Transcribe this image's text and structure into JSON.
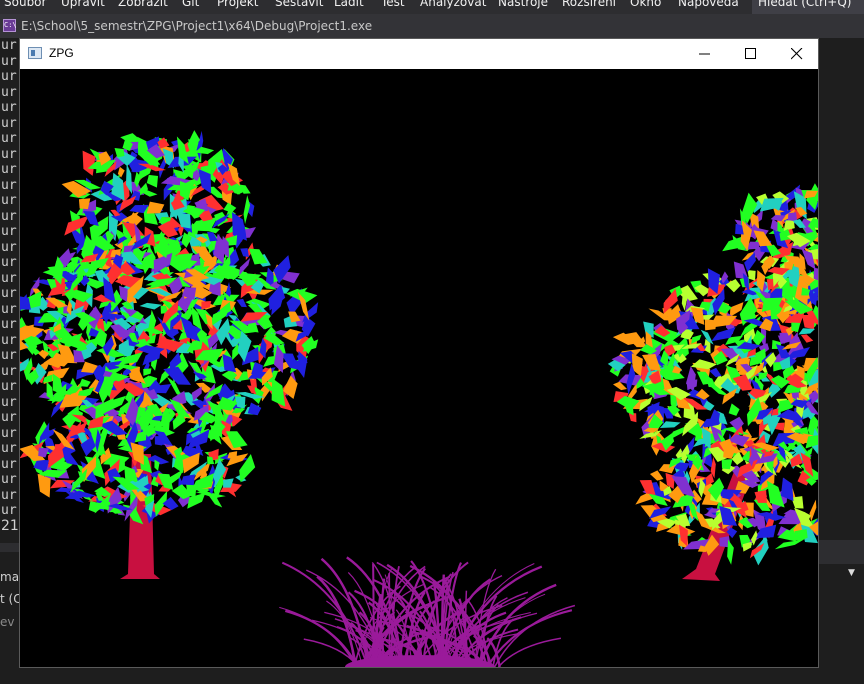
{
  "menubar": {
    "items": [
      "Soubor",
      "Upravit",
      "Zobrazit",
      "Git",
      "Projekt",
      "Sestavit",
      "Ladit",
      "Test",
      "Analyzovat",
      "Nástroje",
      "Rozšíření",
      "Okno",
      "Nápověda"
    ],
    "search_label": "Hledat (Ctrl+Q)"
  },
  "console": {
    "icon_label": "C:\\",
    "path": "E:\\School\\5_semestr\\ZPG\\Project1\\x64\\Debug\\Project1.exe",
    "lines": [
      "ur",
      "ur",
      "ur",
      "ur",
      "ur",
      "ur",
      "ur",
      "ur",
      "ur",
      "ur",
      "ur",
      "ur",
      "ur",
      "ur",
      "ur",
      "ur",
      "ur",
      "ur",
      "ur",
      "ur",
      "ur",
      "ur",
      "ur",
      "ur",
      "ur",
      "ur",
      "ur",
      "ur",
      "ur",
      "ur",
      "ur"
    ]
  },
  "background_ide": {
    "fragment_1": "21",
    "fragment_2": "mati",
    "fragment_3": "t (C",
    "fragment_4": "ev"
  },
  "app_window": {
    "title": "ZPG",
    "icons": [
      "app-window-icon",
      "minimize-icon",
      "maximize-icon",
      "close-icon"
    ],
    "colors": {
      "tree_trunk": "#c81040",
      "grass": "#9a1a9a",
      "leaf_green": "#22ff22",
      "leaf_blue": "#2020e0",
      "leaf_red": "#ff3030",
      "leaf_orange": "#ff9a10",
      "leaf_cyan": "#22d0c0",
      "leaf_purple": "#8030d0"
    }
  }
}
